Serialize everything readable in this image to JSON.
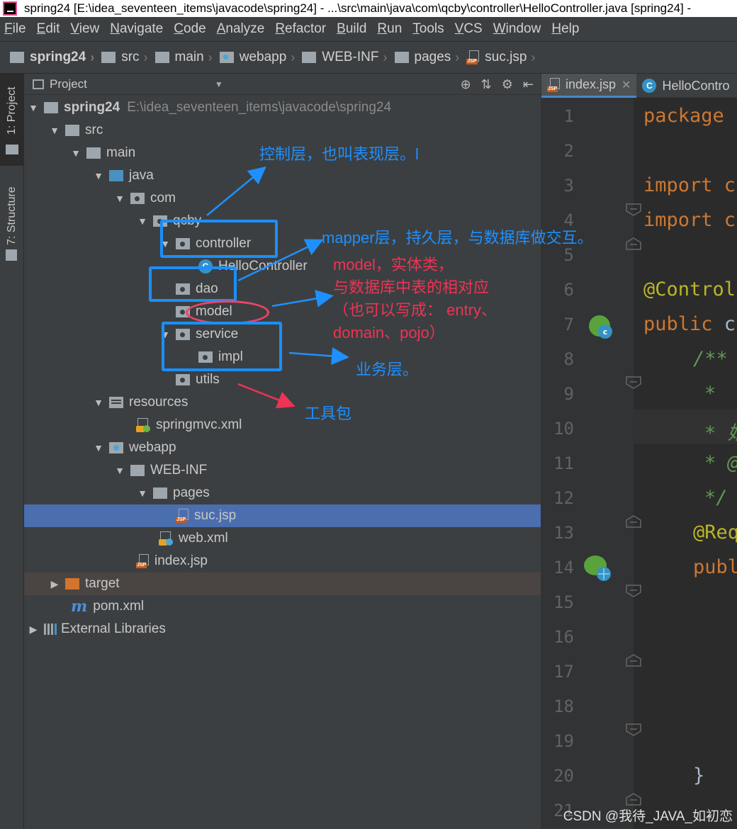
{
  "titlebar": {
    "title": "spring24 [E:\\idea_seventeen_items\\javacode\\spring24] - ...\\src\\main\\java\\com\\qcby\\controller\\HelloController.java [spring24] -"
  },
  "menu": [
    "File",
    "Edit",
    "View",
    "Navigate",
    "Code",
    "Analyze",
    "Refactor",
    "Build",
    "Run",
    "Tools",
    "VCS",
    "Window",
    "Help"
  ],
  "breadcrumb": [
    "spring24",
    "src",
    "main",
    "webapp",
    "WEB-INF",
    "pages",
    "suc.jsp"
  ],
  "stripe": {
    "project_tab": "1: Project",
    "structure_tab": "7: Structure"
  },
  "panel": {
    "title": "Project"
  },
  "tree": [
    {
      "label": "spring24",
      "extra": "E:\\idea_seventeen_items\\javacode\\spring24"
    },
    {
      "label": "src"
    },
    {
      "label": "main"
    },
    {
      "label": "java"
    },
    {
      "label": "com"
    },
    {
      "label": "qcby"
    },
    {
      "label": "controller"
    },
    {
      "label": "HelloController"
    },
    {
      "label": "dao"
    },
    {
      "label": "model"
    },
    {
      "label": "service"
    },
    {
      "label": "impl"
    },
    {
      "label": "utils"
    },
    {
      "label": "resources"
    },
    {
      "label": "springmvc.xml"
    },
    {
      "label": "webapp"
    },
    {
      "label": "WEB-INF"
    },
    {
      "label": "pages"
    },
    {
      "label": "suc.jsp"
    },
    {
      "label": "web.xml"
    },
    {
      "label": "index.jsp"
    },
    {
      "label": "target"
    },
    {
      "label": "pom.xml"
    },
    {
      "label": "External Libraries"
    }
  ],
  "editor": {
    "tabs": [
      {
        "label": "index.jsp"
      },
      {
        "label": "HelloContro"
      }
    ],
    "line_numbers": [
      "1",
      "2",
      "3",
      "4",
      "5",
      "6",
      "7",
      "8",
      "9",
      "10",
      "11",
      "12",
      "13",
      "14",
      "15",
      "16",
      "17",
      "18",
      "19",
      "20",
      "21"
    ],
    "code": {
      "l1": "package",
      "l3": "import c",
      "l4": "import c",
      "l6": "@Control",
      "l7a": "public",
      "l7b": " c",
      "l8": "/**",
      "l9": "*",
      "l10": "* 始",
      "l11": "* @",
      "l12": "*/",
      "l13": "@Req",
      "l14": "publ",
      "l20": "}"
    }
  },
  "annotations": {
    "controller_note": "控制层，也叫表现层。l",
    "dao_note": "mapper层，持久层，与数据库做交互。",
    "model_note_1": "model，实体类，",
    "model_note_2": "与数据库中表的相对应",
    "model_note_3": "（也可以写成： entry、",
    "model_note_4": "domain、pojo）",
    "service_note": "业务层。",
    "utils_note": "工具包"
  },
  "watermark": "CSDN @我待_JAVA_如初恋",
  "colors": {
    "selection": "#4b6eaf",
    "annotation_blue": "#1e90ff",
    "annotation_red": "#ee3355"
  }
}
